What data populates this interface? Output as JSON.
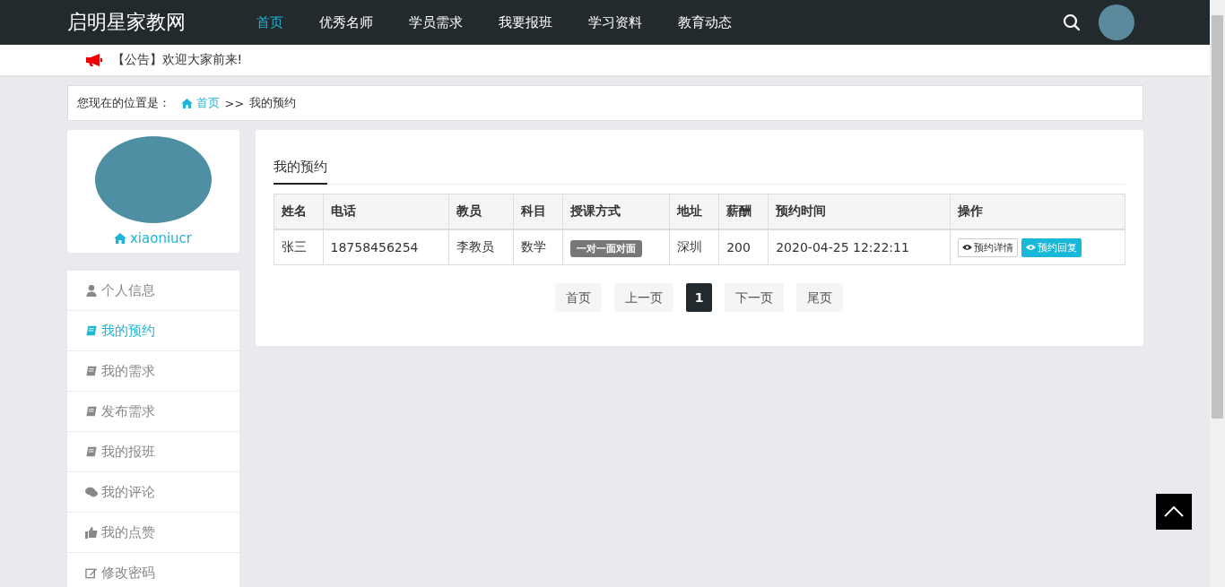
{
  "header": {
    "logo": "启明星家教网",
    "nav": [
      {
        "label": "首页",
        "selected": true
      },
      {
        "label": "优秀名师",
        "selected": false
      },
      {
        "label": "学员需求",
        "selected": false
      },
      {
        "label": "我要报班",
        "selected": false
      },
      {
        "label": "学习资料",
        "selected": false
      },
      {
        "label": "教育动态",
        "selected": false
      }
    ]
  },
  "notice": "【公告】欢迎大家前来!",
  "breadcrumb": {
    "label": "您现在的位置是：",
    "home": "首页",
    "separator": ">>",
    "current": "我的预约"
  },
  "profile": {
    "username": "xiaoniucr"
  },
  "sidebar": {
    "items": [
      {
        "label": "个人信息",
        "kind": "user",
        "selected": false
      },
      {
        "label": "我的预约",
        "kind": "book",
        "selected": true
      },
      {
        "label": "我的需求",
        "kind": "book",
        "selected": false
      },
      {
        "label": "发布需求",
        "kind": "book",
        "selected": false
      },
      {
        "label": "我的报班",
        "kind": "book",
        "selected": false
      },
      {
        "label": "我的评论",
        "kind": "comments",
        "selected": false
      },
      {
        "label": "我的点赞",
        "kind": "thumb",
        "selected": false
      },
      {
        "label": "修改密码",
        "kind": "edit",
        "selected": false
      }
    ]
  },
  "panel": {
    "tab": "我的预约",
    "table": {
      "columns": [
        "姓名",
        "电话",
        "教员",
        "科目",
        "授课方式",
        "地址",
        "薪酬",
        "预约时间",
        "操作"
      ],
      "rows": [
        {
          "name": "张三",
          "phone": "18758456254",
          "teacher": "李教员",
          "subject": "数学",
          "mode": "一对一面对面",
          "address": "深圳",
          "salary": "200",
          "time": "2020-04-25 12:22:11",
          "actions": [
            {
              "label": "预约详情",
              "kind": "default"
            },
            {
              "label": "预约回复",
              "kind": "info"
            }
          ]
        }
      ]
    },
    "pagination": [
      {
        "label": "首页",
        "selected": false
      },
      {
        "label": "上一页",
        "selected": false
      },
      {
        "label": "1",
        "selected": true
      },
      {
        "label": "下一页",
        "selected": false
      },
      {
        "label": "尾页",
        "selected": false
      }
    ]
  }
}
